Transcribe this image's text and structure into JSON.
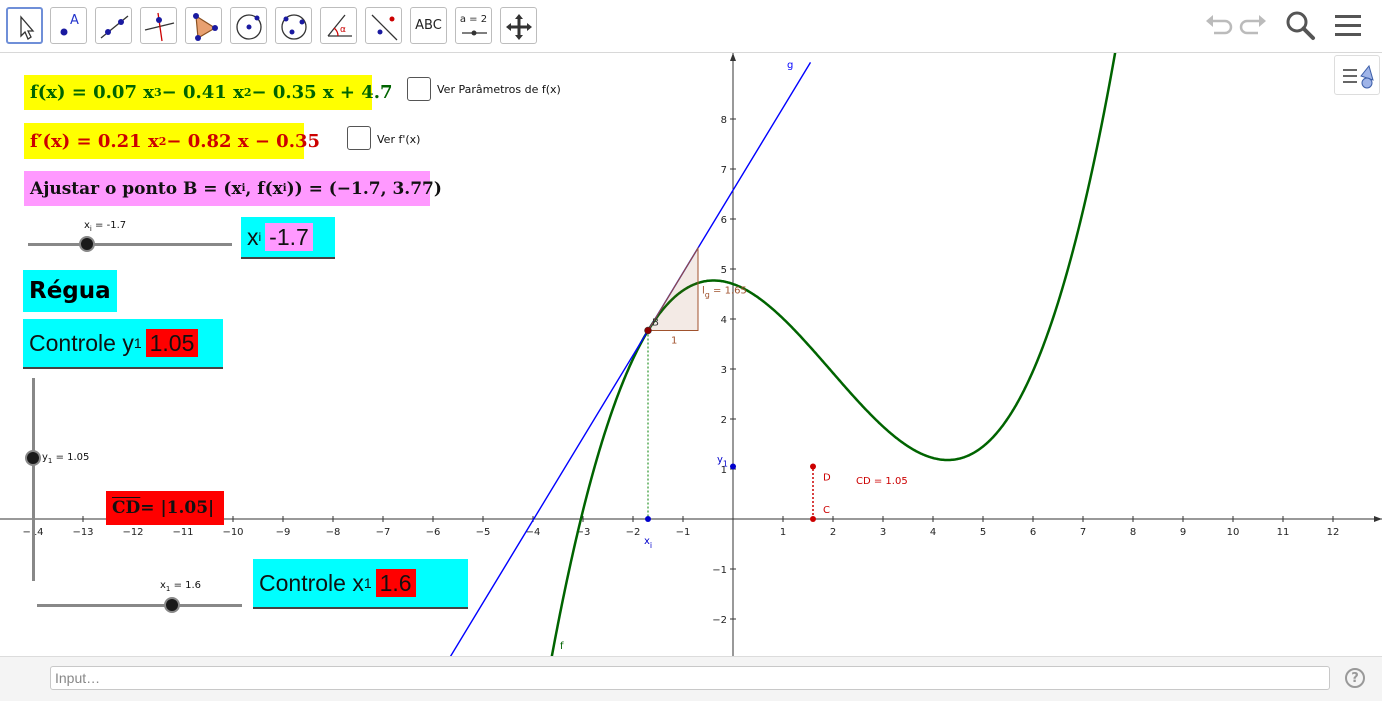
{
  "toolbar": {
    "tools": [
      {
        "icon": "move-arrow-icon"
      },
      {
        "icon": "point-icon",
        "label": "A"
      },
      {
        "icon": "line-icon"
      },
      {
        "icon": "perpendicular-line-icon"
      },
      {
        "icon": "polygon-icon"
      },
      {
        "icon": "circle-center-icon"
      },
      {
        "icon": "circle-three-points-icon"
      },
      {
        "icon": "angle-icon",
        "label": "α"
      },
      {
        "icon": "reflect-line-icon"
      },
      {
        "icon": "text-icon",
        "label": "ABC"
      },
      {
        "icon": "slider-icon",
        "label": "a = 2"
      },
      {
        "icon": "move-graphics-icon"
      }
    ],
    "right_icons": [
      "undo-icon",
      "redo-icon",
      "search-icon",
      "menu-icon"
    ]
  },
  "panels": {
    "f": {
      "prefix": "f(x) = 0.07 x",
      "e1": "3",
      "mid1": " − 0.41 x",
      "e2": "2",
      "rest": " − 0.35 x + 4.7"
    },
    "fprime": {
      "prefix": "f′(x) = 0.21 x",
      "e1": "2",
      "rest": " − 0.82 x − 0.35"
    },
    "pointB": {
      "text": "Ajustar o ponto B = (x",
      "sub1": "i",
      "mid": ", f(x",
      "sub2": "i",
      "rest": ")) = (−1.7, 3.77)"
    },
    "regua": "Régua",
    "cd": {
      "over": "CD",
      "rest": " = |1.05|"
    }
  },
  "checkboxes": {
    "ver_param": "Ver Parâmetros de f(x)",
    "ver_fprime": "Ver f'(x)"
  },
  "sliders": {
    "xi": {
      "name": "x",
      "sub": "i",
      "label_rest": " = -1.7",
      "value": -1.7,
      "min": -4,
      "max": 4
    },
    "y1": {
      "name": "y",
      "sub": "1",
      "label_rest": " = 1.05",
      "value": 1.05,
      "min": -5,
      "max": 5
    },
    "x1": {
      "name": "x",
      "sub": "1",
      "label_rest": " = 1.6",
      "value": 1.6,
      "min": -5,
      "max": 5
    }
  },
  "inputs": {
    "xi": {
      "label": "x",
      "sub": "i",
      "value": "-1.7",
      "color": "#ff99ff"
    },
    "y1": {
      "label": "Controle y",
      "sub": "1",
      "value": "1.05",
      "color": "#ff0000"
    },
    "x1": {
      "label": "Controle x",
      "sub": "1",
      "value": "1.6",
      "color": "#ff0000"
    }
  },
  "graph": {
    "x_ticks": [
      "−14",
      "−13",
      "−12",
      "−11",
      "−10",
      "−9",
      "−8",
      "−7",
      "−6",
      "−5",
      "−4",
      "−3",
      "−2",
      "−1",
      "1",
      "2",
      "3",
      "4",
      "5",
      "6",
      "7",
      "8",
      "9",
      "10",
      "11",
      "12"
    ],
    "y_ticks": [
      "−2",
      "−1",
      "1",
      "2",
      "3",
      "4",
      "5",
      "6",
      "7",
      "8"
    ],
    "labels": {
      "g": "g",
      "f": "f",
      "B": "B",
      "slope_one": "1",
      "slope_name": "l",
      "slope_sub": "g",
      "slope_value": " = 1.65",
      "xi": "x",
      "xi_sub": "i",
      "y1": "y",
      "y1_sub": "1",
      "D": "D",
      "C": "C",
      "CD": "CD = 1.05"
    }
  },
  "input_bar": {
    "placeholder": "Input…"
  },
  "colors": {
    "curve": "#006400",
    "tangent": "#0000ff",
    "segment": "#cc0000",
    "slope": "#a0522d"
  }
}
